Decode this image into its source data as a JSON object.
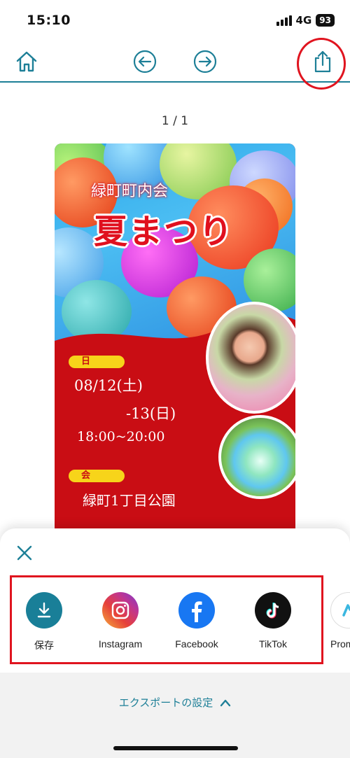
{
  "status_bar": {
    "time": "15:10",
    "network": "4G",
    "battery": "93"
  },
  "toolbar": {
    "home_icon": "home-icon",
    "undo_icon": "undo-icon",
    "redo_icon": "redo-icon",
    "share_icon": "share-icon",
    "accent_color": "#1d7f97",
    "highlight_color": "#e0141f"
  },
  "page_counter": "1 / 1",
  "poster": {
    "organizer": "緑町町内会",
    "title": "夏まつり",
    "date_label": "日　時",
    "date_line1": "08/12(土)",
    "date_line2": "-13(日)",
    "time": "18:00~20:00",
    "venue_label": "会　場",
    "venue": "緑町1丁目公園"
  },
  "share_sheet": {
    "close_icon": "close-icon",
    "items": [
      {
        "label": "保存",
        "icon": "download-icon",
        "color": "#197f98"
      },
      {
        "label": "Instagram",
        "icon": "instagram-icon",
        "color": "#c1358f"
      },
      {
        "label": "Facebook",
        "icon": "facebook-icon",
        "color": "#1877f2"
      },
      {
        "label": "TikTok",
        "icon": "tiktok-icon",
        "color": "#111111"
      },
      {
        "label": "Prom",
        "icon": "promeo-icon",
        "color": "#3bb7e0"
      }
    ],
    "export_settings": "エクスポートの設定"
  }
}
